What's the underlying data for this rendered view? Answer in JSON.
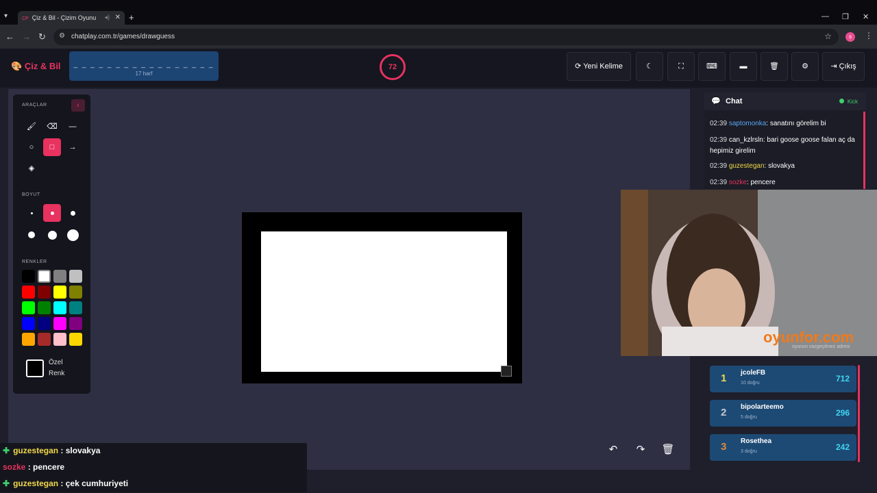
{
  "browser": {
    "tab_title": "Çiz & Bil - Çizim Oyunu",
    "tab_favicon": "CP",
    "url": "chatplay.com.tr/games/drawguess",
    "profile_initial": "s"
  },
  "header": {
    "logo": "Çiz & Bil",
    "word_hint": "_ _ _ _ _ _ _ _ _ _ _ _ _ _ _ _ _",
    "letter_count": "17 harf",
    "timer": "72",
    "new_word": "Yeni Kelime",
    "exit": "Çıkış"
  },
  "tools": {
    "title": "ARAÇLAR",
    "size_title": "BOYUT",
    "colors_title": "RENKLER",
    "custom_color": "Özel Renk",
    "palette": [
      "#000000",
      "#ffffff",
      "#808080",
      "#c0c0c0",
      "#ff0000",
      "#800000",
      "#ffff00",
      "#808000",
      "#00ff00",
      "#008000",
      "#00ffff",
      "#008080",
      "#0000ff",
      "#000080",
      "#ff00ff",
      "#800080",
      "#ffa500",
      "#a52a2a",
      "#ffc0cb",
      "#ffd700"
    ]
  },
  "chat": {
    "title": "Chat",
    "platform": "Kick",
    "messages": [
      {
        "time": "02:39",
        "user": "saptomonka",
        "color": "#5aa7f5",
        "text": ": sanatını görelim bi"
      },
      {
        "time": "02:39",
        "user": "can_kzlrsln",
        "color": "#ffffff",
        "text": ": bari goose goose falan aç da hepimiz girelim"
      },
      {
        "time": "02:39",
        "user": "guzestegan",
        "color": "#f0d84a",
        "text": ": slovakya"
      },
      {
        "time": "02:39",
        "user": "sozke",
        "color": "#e8325f",
        "text": ": pencere"
      }
    ]
  },
  "stream": {
    "watermark": "oyunfor.com",
    "watermark_sub": "oyunun vazgeçilmez adresi"
  },
  "leaderboard": [
    {
      "rank": "1",
      "name": "jcoleFB",
      "sub": "10 doğru",
      "score": "712",
      "rank_color": "#f0d84a"
    },
    {
      "rank": "2",
      "name": "bipolarteemo",
      "sub": "5 doğru",
      "score": "296",
      "rank_color": "#c8c8d0"
    },
    {
      "rank": "3",
      "name": "Rosethea",
      "sub": "3 doğru",
      "score": "242",
      "rank_color": "#e08a3c"
    }
  ],
  "overlay_chat": [
    {
      "plus": "✚",
      "user": "guzestegan",
      "color": "#f0d84a",
      "text": " : slovakya"
    },
    {
      "plus": "",
      "user": "sozke",
      "color": "#e8325f",
      "text": " : pencere"
    },
    {
      "plus": "✚",
      "user": "guzestegan",
      "color": "#f0d84a",
      "text": " : çek cumhuriyeti"
    }
  ]
}
